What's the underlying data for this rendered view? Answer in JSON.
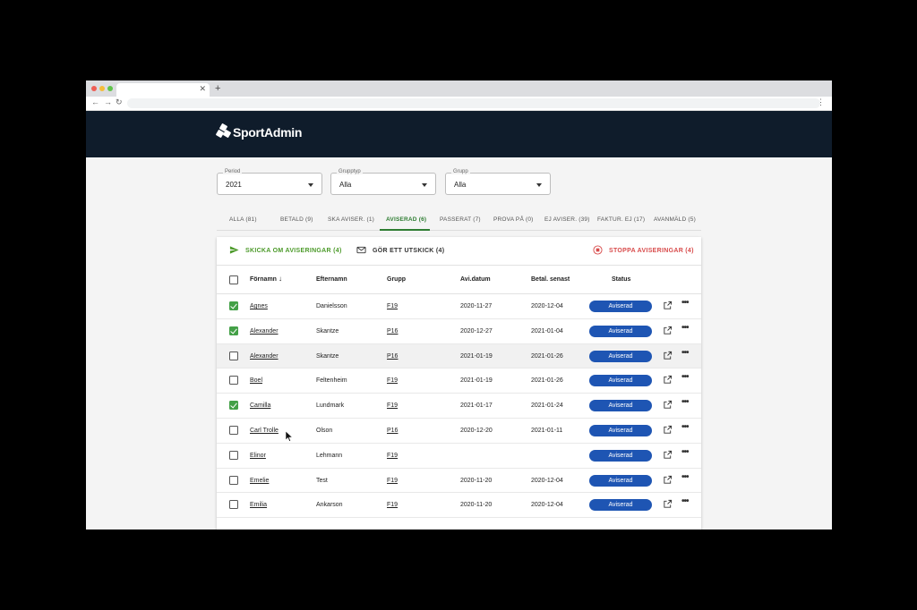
{
  "app": {
    "logo_text": "SportAdmin"
  },
  "filters": [
    {
      "label": "Period",
      "value": "2021"
    },
    {
      "label": "Grupptyp",
      "value": "Alla"
    },
    {
      "label": "Grupp",
      "value": "Alla"
    }
  ],
  "tabs": [
    {
      "label": "ALLA (81)"
    },
    {
      "label": "BETALD (9)"
    },
    {
      "label": "SKA AVISER. (1)"
    },
    {
      "label": "AVISERAD (6)"
    },
    {
      "label": "PASSERAT (7)"
    },
    {
      "label": "PROVA PÅ (0)"
    },
    {
      "label": "EJ AVISER. (39)"
    },
    {
      "label": "FAKTUR. EJ (17)"
    },
    {
      "label": "AVANMÄLD (5)"
    }
  ],
  "actions": {
    "resend": "SKICKA OM AVISERINGAR (4)",
    "mail": "GÖR ETT UTSKICK (4)",
    "stop": "STOPPA AVISERINGAR (4)",
    "resend_color": "#4c9a2a",
    "stop_color": "#d84b4b"
  },
  "table": {
    "columns": {
      "firstname": "Förnamn",
      "lastname": "Efternamn",
      "group": "Grupp",
      "avi_date": "Avi.datum",
      "pay_by": "Betal. senast",
      "status": "Status"
    },
    "rows": [
      {
        "checked": true,
        "firstname": "Agnes",
        "lastname": "Danielsson",
        "group": "F19",
        "avi_date": "2020-11-27",
        "pay_by": "2020-12-04",
        "status": "Aviserad"
      },
      {
        "checked": true,
        "firstname": "Alexander",
        "lastname": "Skantze",
        "group": "P16",
        "avi_date": "2020-12-27",
        "pay_by": "2021-01-04",
        "status": "Aviserad"
      },
      {
        "checked": false,
        "firstname": "Alexander",
        "lastname": "Skantze",
        "group": "P16",
        "avi_date": "2021-01-19",
        "pay_by": "2021-01-26",
        "status": "Aviserad"
      },
      {
        "checked": false,
        "firstname": "Boel",
        "lastname": "Feltenheim",
        "group": "F19",
        "avi_date": "2021-01-19",
        "pay_by": "2021-01-26",
        "status": "Aviserad"
      },
      {
        "checked": true,
        "firstname": "Camilla",
        "lastname": "Lundmark",
        "group": "F19",
        "avi_date": "2021-01-17",
        "pay_by": "2021-01-24",
        "status": "Aviserad"
      },
      {
        "checked": false,
        "firstname": "Carl Trolle",
        "lastname": "Olson",
        "group": "P16",
        "avi_date": "2020-12-20",
        "pay_by": "2021-01-11",
        "status": "Aviserad"
      },
      {
        "checked": false,
        "firstname": "Elinor",
        "lastname": "Lehmann",
        "group": "F19",
        "avi_date": "",
        "pay_by": "",
        "status": "Aviserad"
      },
      {
        "checked": false,
        "firstname": "Emelie",
        "lastname": "Test",
        "group": "F19",
        "avi_date": "2020-11-20",
        "pay_by": "2020-12-04",
        "status": "Aviserad"
      },
      {
        "checked": false,
        "firstname": "Emilia",
        "lastname": "Ankarson",
        "group": "F19",
        "avi_date": "2020-11-20",
        "pay_by": "2020-12-04",
        "status": "Aviserad"
      }
    ]
  },
  "colors": {
    "header_bg": "#0f1c2b",
    "accent_green": "#2e7d32",
    "badge_blue": "#1e55b3"
  }
}
